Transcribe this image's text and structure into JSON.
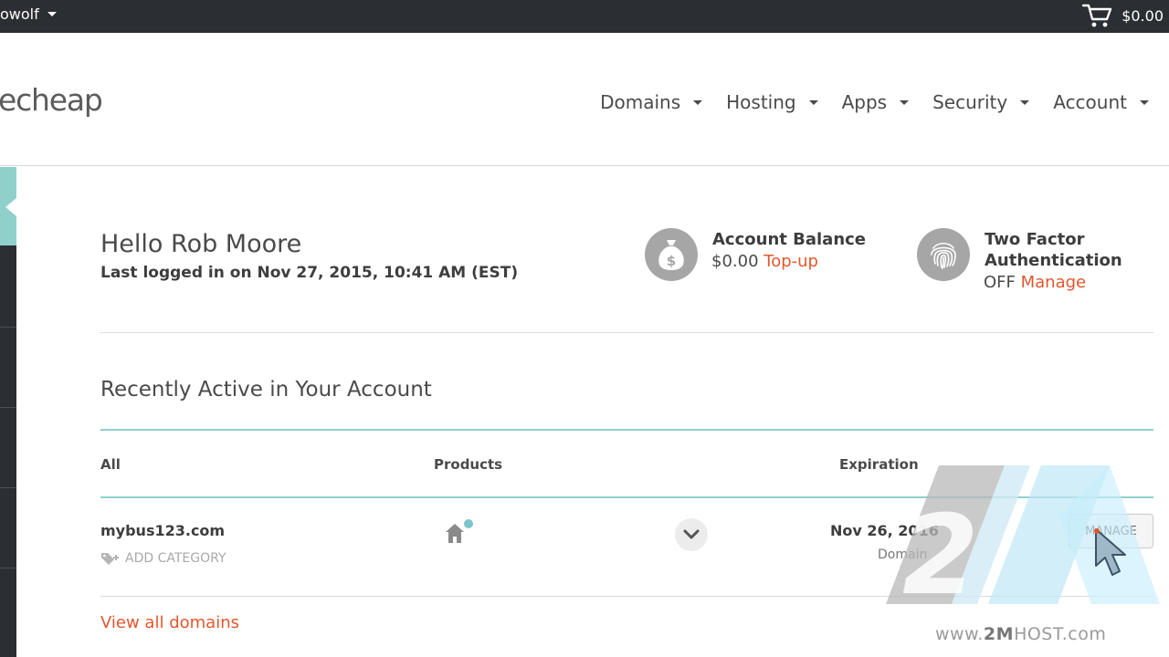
{
  "topbar": {
    "username": "owolf",
    "cart_total": "$0.00"
  },
  "header": {
    "logo_text": "echeap",
    "nav": [
      {
        "label": "Domains"
      },
      {
        "label": "Hosting"
      },
      {
        "label": "Apps"
      },
      {
        "label": "Security"
      },
      {
        "label": "Account"
      }
    ]
  },
  "greeting": {
    "hello": "Hello Rob Moore",
    "last_login": "Last logged in on Nov 27, 2015, 10:41 AM (EST)"
  },
  "balance": {
    "title": "Account Balance",
    "amount": "$0.00",
    "action": "Top-up"
  },
  "two_factor": {
    "title_line1": "Two Factor",
    "title_line2": "Authentication",
    "status": "OFF",
    "action": "Manage"
  },
  "recent": {
    "title": "Recently Active in Your Account",
    "columns": {
      "all": "All",
      "products": "Products",
      "expiration": "Expiration"
    },
    "row": {
      "domain": "mybus123.com",
      "add_category": "ADD CATEGORY",
      "expiration_date": "Nov 26, 2016",
      "product_type": "Domain",
      "manage_label": "MANAGE"
    },
    "view_all": "View all domains"
  },
  "watermark": {
    "prefix": "www.",
    "brand": "2M",
    "suffix": "HOST.com"
  },
  "colors": {
    "topbar_bg": "#2b2f33",
    "accent_teal": "#8fd0cb",
    "link_orange": "#e2572d",
    "status_dot": "#7bc4cc"
  },
  "icons": {
    "cart": "cart-icon",
    "balance": "money-bag-icon",
    "two_factor": "fingerprint-icon",
    "product": "home-icon",
    "expand": "chevron-down-icon",
    "category": "tag-plus-icon"
  }
}
